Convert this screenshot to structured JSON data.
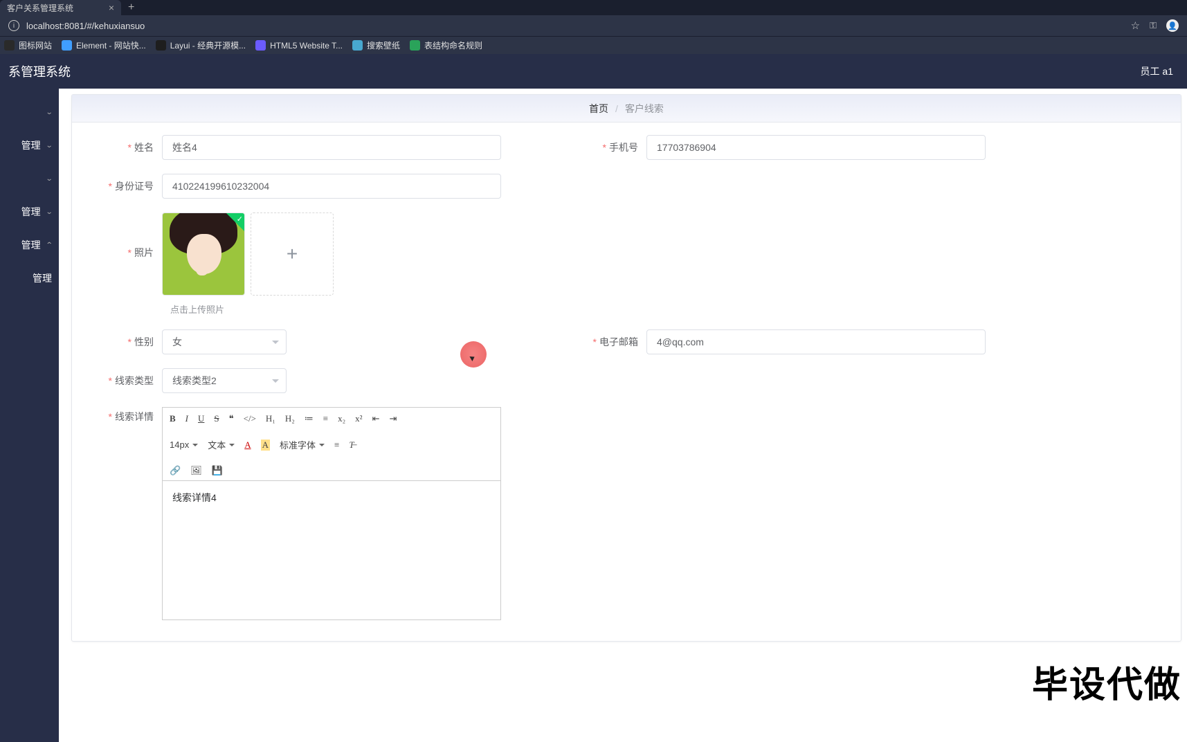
{
  "browser": {
    "tab_title": "客户关系管理系统",
    "url": "localhost:8081/#/kehuxiansuo",
    "bookmarks": [
      {
        "label": "图标网站",
        "color": "#2a2a2a"
      },
      {
        "label": "Element - 网站快...",
        "color": "#409eff"
      },
      {
        "label": "Layui - 经典开源模...",
        "color": "#1e1e1e"
      },
      {
        "label": "HTML5 Website T...",
        "color": "#6b5bff"
      },
      {
        "label": "搜索壁纸",
        "color": "#48a8d0"
      },
      {
        "label": "表结构命名规则",
        "color": "#2aa35a"
      }
    ]
  },
  "header": {
    "title": "系管理系统",
    "user": "员工 a1"
  },
  "sidebar": {
    "items": [
      {
        "label": ""
      },
      {
        "label": "管理"
      },
      {
        "label": ""
      },
      {
        "label": "管理"
      },
      {
        "label": "管理"
      },
      {
        "label": "管理"
      }
    ]
  },
  "breadcrumb": {
    "home": "首页",
    "current": "客户线索"
  },
  "form": {
    "name_label": "姓名",
    "name_value": "姓名4",
    "phone_label": "手机号",
    "phone_value": "17703786904",
    "idcard_label": "身份证号",
    "idcard_value": "410224199610232004",
    "photo_label": "照片",
    "photo_hint": "点击上传照片",
    "gender_label": "性别",
    "gender_value": "女",
    "email_label": "电子邮箱",
    "email_value": "4@qq.com",
    "leadtype_label": "线索类型",
    "leadtype_value": "线索类型2",
    "detail_label": "线索详情",
    "detail_value": "线索详情4"
  },
  "editor_toolbar": {
    "font_size": "14px",
    "block_type": "文本",
    "font_family": "标准字体"
  },
  "watermark": "毕设代做"
}
